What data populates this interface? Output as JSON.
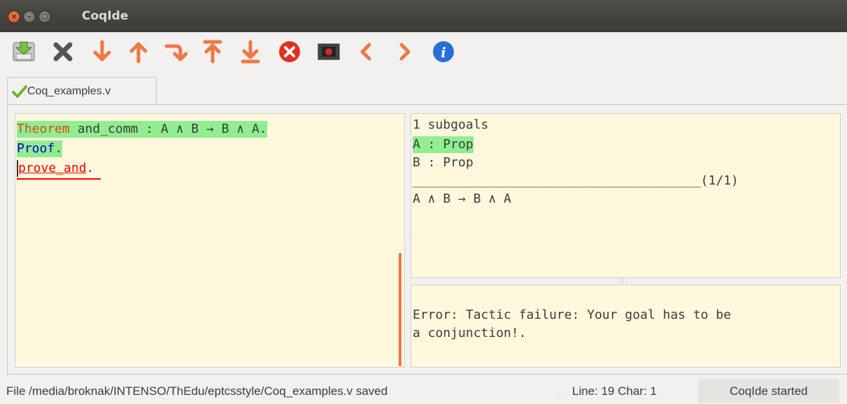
{
  "window": {
    "title": "CoqIde"
  },
  "toolbar": {
    "buttons": [
      {
        "name": "save",
        "icon": "save-icon"
      },
      {
        "name": "close",
        "icon": "close-x-icon"
      },
      {
        "name": "forward",
        "icon": "arrow-down-icon"
      },
      {
        "name": "backward",
        "icon": "arrow-up-icon"
      },
      {
        "name": "go-to-cursor",
        "icon": "arrow-curve-icon"
      },
      {
        "name": "restart",
        "icon": "arrow-to-top-icon"
      },
      {
        "name": "go-to-end",
        "icon": "arrow-to-bottom-icon"
      },
      {
        "name": "interrupt",
        "icon": "stop-circle-icon"
      },
      {
        "name": "stop",
        "icon": "stop-screen-icon"
      },
      {
        "name": "previous",
        "icon": "chevron-left-icon"
      },
      {
        "name": "next",
        "icon": "chevron-right-icon"
      },
      {
        "name": "about",
        "icon": "info-icon"
      }
    ],
    "accent": "#f07746"
  },
  "tabs": [
    {
      "label": "Coq_examples.v",
      "status_icon": "checkmark-icon"
    }
  ],
  "editor": {
    "line1": {
      "keyword": "Theorem",
      "rest": " and_comm : A ∧ B → B ∧ A."
    },
    "line2": {
      "keyword": "Proof",
      "punct": "."
    },
    "line3": {
      "tactic": "prove_and",
      "punct": "."
    }
  },
  "goals": {
    "count": "1 subgoals",
    "hyps": [
      "A : Prop",
      "B : Prop"
    ],
    "separator": "______________________________________(1/1)",
    "goal": "A ∧ B → B ∧ A"
  },
  "messages": {
    "line1": "Error: Tactic failure: Your goal has to be",
    "line2": "a conjunction!."
  },
  "statusbar": {
    "file": "File /media/broknak/INTENSO/ThEdu/eptcsstyle/Coq_examples.v saved",
    "position": "Line:  19 Char:  1",
    "state": "CoqIde started"
  },
  "colors": {
    "processed": "#90ee90",
    "keyword_orange": "#dd4814",
    "keyword_blue": "#0000d8",
    "error": "#ff0000",
    "background": "#fff8dc"
  }
}
